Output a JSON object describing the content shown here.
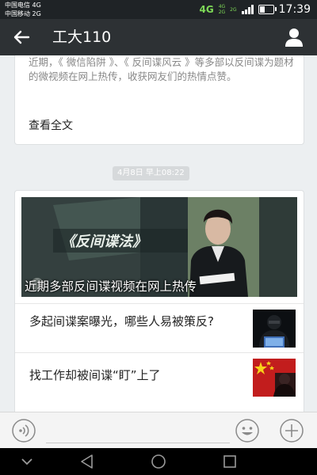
{
  "status_bar": {
    "carrier_1": "中国电信 4G",
    "carrier_2": "中国移动 2G",
    "network_main": "4G",
    "network_sub_1": "4G",
    "network_sub_2": "2G",
    "network_sub_3": "2G",
    "battery_level": 0.4,
    "time": "17:39"
  },
  "header": {
    "title": "工大110",
    "back_icon": "arrow-left-icon",
    "profile_icon": "user-icon"
  },
  "messages": {
    "card1": {
      "snippet": "近期，《 微信陷阱 》、《 反间谍风云 》等多部以反间谍为题材的微视频在网上热传，收获网友们的热情点赞。",
      "read_more": "查看全文"
    },
    "timestamp": "4月8日 早上08:22",
    "card2": {
      "cover_title": "近期多部反间谍视频在网上热传",
      "cover_badge": "《反间谍法》",
      "articles": [
        {
          "title": "多起间谍案曝光，哪些人易被策反?",
          "thumb_icon": "hacker-image"
        },
        {
          "title": "找工作却被间谍“盯”上了",
          "thumb_icon": "flag-image"
        }
      ]
    }
  },
  "input_bar": {
    "voice_icon": "voice-icon",
    "placeholder": "",
    "emoji_icon": "emoji-icon",
    "plus_icon": "plus-icon"
  },
  "nav_bar": [
    "chevron-down-icon",
    "back-triangle-icon",
    "home-circle-icon",
    "recent-square-icon"
  ],
  "colors": {
    "header_bg": "#2d3134",
    "status_bg": "#1f2326",
    "page_bg": "#eceff1",
    "network_green": "#7ed957"
  }
}
